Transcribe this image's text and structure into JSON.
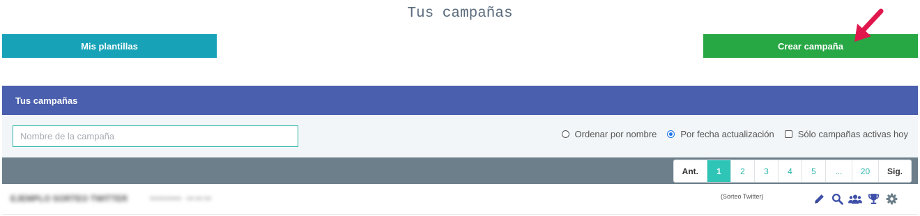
{
  "page": {
    "title": "Tus campañas"
  },
  "buttons": {
    "templates_label": "Mis plantillas",
    "create_label": "Crear campaña"
  },
  "card": {
    "header": "Tus campañas",
    "search_placeholder": "Nombre de la campaña",
    "sort_options": [
      {
        "label": "Ordenar por nombre",
        "checked": false
      },
      {
        "label": "Por fecha actualización",
        "checked": true
      }
    ],
    "active_only": {
      "label": "Sólo campañas activas hoy",
      "checked": false
    }
  },
  "pagination": {
    "prev": "Ant.",
    "next": "Sig.",
    "pages": [
      "1",
      "2",
      "3",
      "4",
      "5",
      "...",
      "20"
    ],
    "current": "1"
  },
  "campaigns": [
    {
      "name": "EJEMPLO SORTEO TWITTER",
      "date": "00/00/0000 - 00:00:00",
      "type": "(Sorteo Twitter)",
      "actions": [
        "pencil-icon",
        "search-icon",
        "users-icon",
        "trophy-icon",
        "gear-icon"
      ]
    }
  ],
  "colors": {
    "templates_button": "#17a2b8",
    "create_button": "#28a745",
    "card_header": "#4a5fad",
    "pager_bar": "#6c7f8a",
    "page_active": "#2ec4b6",
    "arrow": "#e0174d",
    "action_icons": "#3d4fa8"
  }
}
